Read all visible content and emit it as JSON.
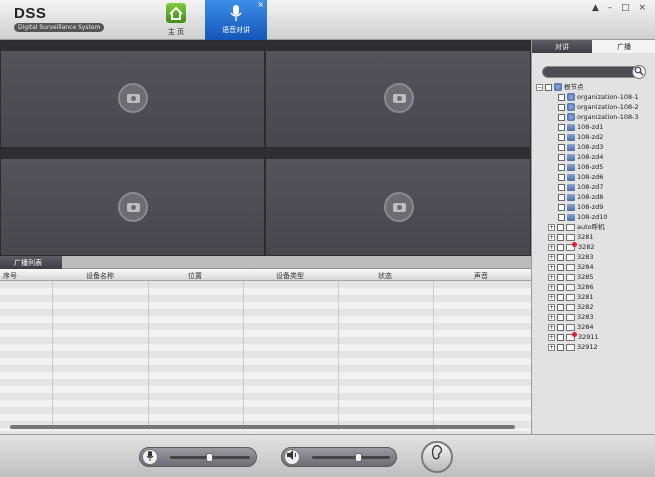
{
  "app": {
    "logo": "DSS",
    "subtitle": "Digital Surveillance System"
  },
  "tabs": {
    "home": "主 页",
    "voice": "语音对讲",
    "close": "×"
  },
  "window_controls": "▲ – □ ×",
  "broadcast": {
    "tab_label": "广播列表",
    "columns": [
      "序号",
      "设备名称",
      "位置",
      "设备类型",
      "状态",
      "声音"
    ]
  },
  "right_panel": {
    "tabs": [
      "对讲",
      "广播"
    ],
    "search_placeholder": "",
    "root": "根节点",
    "org_nodes": [
      "organization-108-1",
      "organization-108-2",
      "organization-108-3"
    ],
    "device_nodes": [
      "108-zd1",
      "108-zd2",
      "108-zd3",
      "108-zd4",
      "108-zd5",
      "108-zd6",
      "108-zd7",
      "108-zd8",
      "108-zd9",
      "108-zd10"
    ],
    "group_nodes": [
      {
        "label": "auto呼机",
        "alert": false
      },
      {
        "label": "3281",
        "alert": false
      },
      {
        "label": "3282",
        "alert": true
      },
      {
        "label": "3283",
        "alert": false
      },
      {
        "label": "3284",
        "alert": false
      },
      {
        "label": "3285",
        "alert": false
      },
      {
        "label": "3286",
        "alert": false
      },
      {
        "label": "3281",
        "alert": false
      },
      {
        "label": "3282",
        "alert": false
      },
      {
        "label": "3283",
        "alert": false
      },
      {
        "label": "3284",
        "alert": false
      },
      {
        "label": "32911",
        "alert": true
      },
      {
        "label": "32912",
        "alert": false
      }
    ]
  },
  "toolbar": {
    "mic_icon": "mic-icon",
    "speaker_icon": "speaker-icon",
    "ptt_icon": "push-to-talk-icon",
    "mic_level": 0.45,
    "speaker_level": 0.55
  }
}
